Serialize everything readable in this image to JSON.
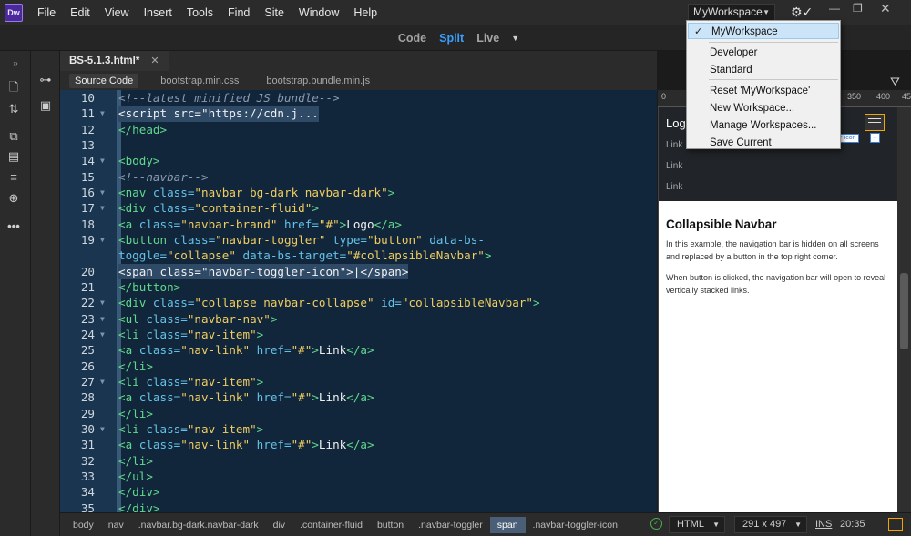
{
  "app": {
    "logo_text": "Dw",
    "brand_color": "#470137"
  },
  "menu": [
    "File",
    "Edit",
    "View",
    "Insert",
    "Tools",
    "Find",
    "Site",
    "Window",
    "Help"
  ],
  "workspace": {
    "current": "MyWorkspace",
    "items": [
      {
        "label": "MyWorkspace",
        "selected": true
      },
      {
        "label": "Developer"
      },
      {
        "label": "Standard"
      },
      {
        "label": "Reset 'MyWorkspace'"
      },
      {
        "label": "New Workspace..."
      },
      {
        "label": "Manage Workspaces..."
      },
      {
        "label": "Save Current"
      }
    ]
  },
  "views": {
    "code": "Code",
    "split": "Split",
    "live": "Live",
    "active": "Split"
  },
  "document": {
    "tab": "BS-5.1.3.html*",
    "related_files": [
      "Source Code",
      "bootstrap.min.css",
      "bootstrap.bundle.min.js"
    ]
  },
  "code_lines": [
    {
      "n": "10",
      "fold": "",
      "html": "<span class='cmt'>&lt;!--latest minified JS bundle--&gt;</span>"
    },
    {
      "n": "11",
      "fold": "▼",
      "html": "<span class='plain'>&lt;script src=\"https://cdn.j...</span>",
      "hl": true
    },
    {
      "n": "12",
      "fold": "",
      "html": "<span class='tag'>&lt;/head&gt;</span>"
    },
    {
      "n": "13",
      "fold": "",
      "html": ""
    },
    {
      "n": "14",
      "fold": "▼",
      "html": "<span class='tag'>&lt;body&gt;</span>"
    },
    {
      "n": "15",
      "fold": "",
      "html": "<span class='cmt'>&lt;!--navbar--&gt;</span>"
    },
    {
      "n": "16",
      "fold": "▼",
      "html": "<span class='tag'>&lt;nav </span><span class='attr'>class=</span><span class='str'>\"navbar bg-dark navbar-dark\"</span><span class='tag'>&gt;</span>"
    },
    {
      "n": "17",
      "fold": "▼",
      "html": "<span class='tag'>&lt;div </span><span class='attr'>class=</span><span class='str'>\"container-fluid\"</span><span class='tag'>&gt;</span>"
    },
    {
      "n": "18",
      "fold": "",
      "html": "<span class='tag'>&lt;a </span><span class='attr'>class=</span><span class='str'>\"navbar-brand\"</span><span class='attr'> href=</span><span class='str'>\"#\"</span><span class='tag'>&gt;</span><span class='plain'>Logo</span><span class='tag'>&lt;/a&gt;</span>"
    },
    {
      "n": "19",
      "fold": "▼",
      "html": "<span class='tag'>&lt;button </span><span class='attr'>class=</span><span class='str'>\"navbar-toggler\"</span><span class='attr'> type=</span><span class='str'>\"button\"</span><span class='attr'> data-bs-</span>"
    },
    {
      "n": "",
      "fold": "",
      "html": "<span class='attr'>toggle=</span><span class='str'>\"collapse\"</span><span class='attr'> data-bs-target=</span><span class='str'>\"#collapsibleNavbar\"</span><span class='tag'>&gt;</span>"
    },
    {
      "n": "20",
      "fold": "",
      "html": "<span class='plain'>&lt;span class=\"navbar-toggler-icon\"&gt;|&lt;/span&gt;</span>",
      "hl": true
    },
    {
      "n": "21",
      "fold": "",
      "html": "<span class='tag'>&lt;/button&gt;</span>"
    },
    {
      "n": "22",
      "fold": "▼",
      "html": "<span class='tag'>&lt;div </span><span class='attr'>class=</span><span class='str'>\"collapse navbar-collapse\"</span><span class='attr'> id=</span><span class='str'>\"collapsibleNavbar\"</span><span class='tag'>&gt;</span>"
    },
    {
      "n": "23",
      "fold": "▼",
      "html": "<span class='tag'>&lt;ul </span><span class='attr'>class=</span><span class='str'>\"navbar-nav\"</span><span class='tag'>&gt;</span>"
    },
    {
      "n": "24",
      "fold": "▼",
      "html": "<span class='tag'>&lt;li </span><span class='attr'>class=</span><span class='str'>\"nav-item\"</span><span class='tag'>&gt;</span>"
    },
    {
      "n": "25",
      "fold": "",
      "html": "<span class='tag'>&lt;a </span><span class='attr'>class=</span><span class='str'>\"nav-link\"</span><span class='attr'> href=</span><span class='str'>\"#\"</span><span class='tag'>&gt;</span><span class='plain'>Link</span><span class='tag'>&lt;/a&gt;</span>"
    },
    {
      "n": "26",
      "fold": "",
      "html": "<span class='tag'>&lt;/li&gt;</span>"
    },
    {
      "n": "27",
      "fold": "▼",
      "html": "<span class='tag'>&lt;li </span><span class='attr'>class=</span><span class='str'>\"nav-item\"</span><span class='tag'>&gt;</span>"
    },
    {
      "n": "28",
      "fold": "",
      "html": "<span class='tag'>&lt;a </span><span class='attr'>class=</span><span class='str'>\"nav-link\"</span><span class='attr'> href=</span><span class='str'>\"#\"</span><span class='tag'>&gt;</span><span class='plain'>Link</span><span class='tag'>&lt;/a&gt;</span>"
    },
    {
      "n": "29",
      "fold": "",
      "html": "<span class='tag'>&lt;/li&gt;</span>"
    },
    {
      "n": "30",
      "fold": "▼",
      "html": "<span class='tag'>&lt;li </span><span class='attr'>class=</span><span class='str'>\"nav-item\"</span><span class='tag'>&gt;</span>"
    },
    {
      "n": "31",
      "fold": "",
      "html": "<span class='tag'>&lt;a </span><span class='attr'>class=</span><span class='str'>\"nav-link\"</span><span class='attr'> href=</span><span class='str'>\"#\"</span><span class='tag'>&gt;</span><span class='plain'>Link</span><span class='tag'>&lt;/a&gt;</span>"
    },
    {
      "n": "32",
      "fold": "",
      "html": "<span class='tag'>&lt;/li&gt;</span>"
    },
    {
      "n": "33",
      "fold": "",
      "html": "<span class='tag'>&lt;/ul&gt;</span>"
    },
    {
      "n": "34",
      "fold": "",
      "html": "<span class='tag'>&lt;/div&gt;</span>"
    },
    {
      "n": "35",
      "fold": "",
      "html": "<span class='tag'>&lt;/div&gt;</span>"
    }
  ],
  "ruler_ticks": [
    "0",
    "350",
    "400",
    "45"
  ],
  "live": {
    "brand": "Logo",
    "links": [
      "Link",
      "Link",
      "Link"
    ],
    "tag_tip": "r-icon",
    "tag_plus": "+",
    "heading": "Collapsible Navbar",
    "para1": "In this example, the navigation bar is hidden on all screens and replaced by a button in the top right corner.",
    "para2": "When button is clicked, the navigation bar will open to reveal vertically stacked links."
  },
  "status": {
    "breadcrumbs": [
      "body",
      "nav",
      ".navbar.bg-dark.navbar-dark",
      "div",
      ".container-fluid",
      "button",
      ".navbar-toggler",
      "span",
      ".navbar-toggler-icon"
    ],
    "active_crumb": "span",
    "doc_type": "HTML",
    "window_size": "291 x 497",
    "insert_mode": "INS",
    "cursor_pos": "20:35"
  }
}
